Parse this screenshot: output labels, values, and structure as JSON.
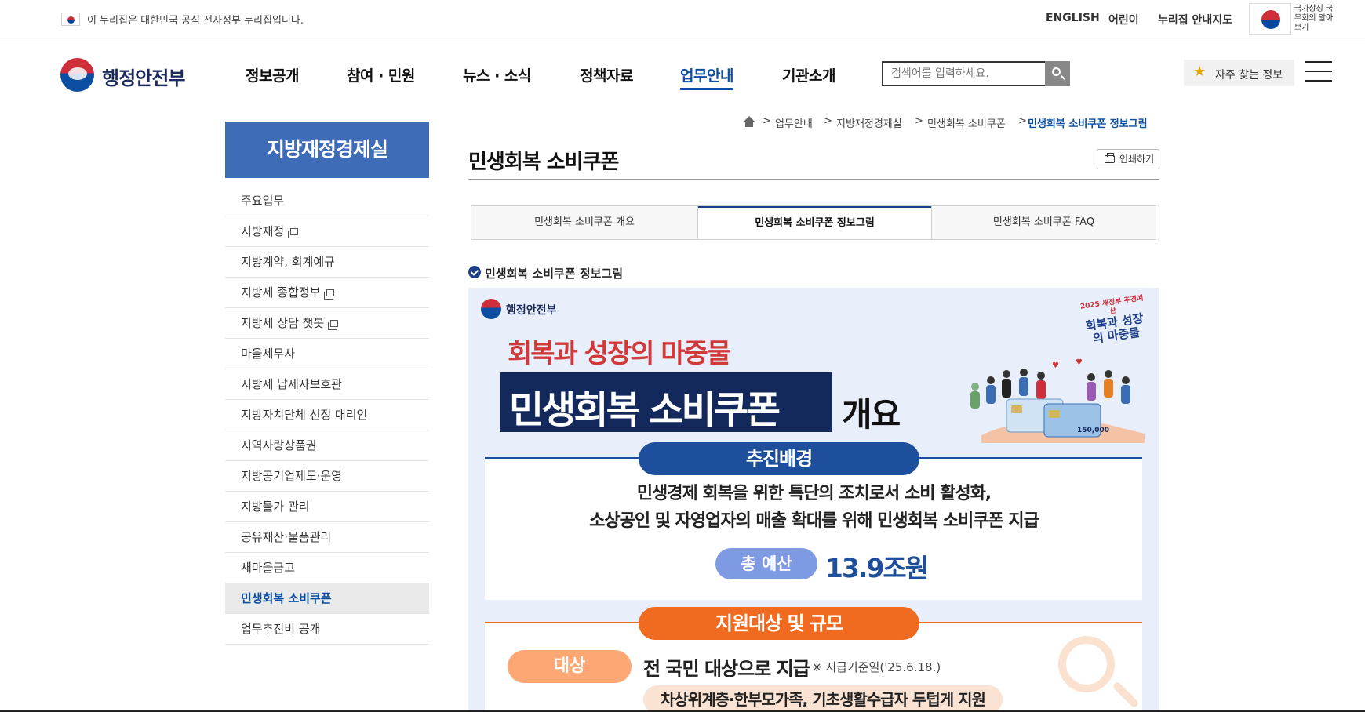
{
  "govbar": {
    "notice": "이 누리집은 대한민국 공식 전자정부 누리집입니다.",
    "links": [
      "ENGLISH",
      "어린이",
      "누리집 안내지도"
    ],
    "national_symbol_label": "국가상징 국무회의 알아보기"
  },
  "header": {
    "logo_text": "행정안전부",
    "gnb": [
      "정보공개",
      "참여 · 민원",
      "뉴스 · 소식",
      "정책자료",
      "업무안내",
      "기관소개"
    ],
    "active_gnb": "업무안내",
    "search_placeholder": "검색어를 입력하세요.",
    "favorite_label": "자주 찾는 정보"
  },
  "lnb": {
    "title": "지방재정경제실",
    "items": [
      {
        "label": "주요업무",
        "external": false
      },
      {
        "label": "지방재정",
        "external": true
      },
      {
        "label": "지방계약, 회계예규",
        "external": false
      },
      {
        "label": "지방세 종합정보",
        "external": true
      },
      {
        "label": "지방세 상담 챗봇",
        "external": true
      },
      {
        "label": "마을세무사",
        "external": false
      },
      {
        "label": "지방세 납세자보호관",
        "external": false
      },
      {
        "label": "지방자치단체 선정 대리인",
        "external": false
      },
      {
        "label": "지역사랑상품권",
        "external": false
      },
      {
        "label": "지방공기업제도·운영",
        "external": false
      },
      {
        "label": "지방물가 관리",
        "external": false
      },
      {
        "label": "공유재산·물품관리",
        "external": false
      },
      {
        "label": "새마을금고",
        "external": false
      },
      {
        "label": "민생회복 소비쿠폰",
        "external": false,
        "active": true
      },
      {
        "label": "업무추진비 공개",
        "external": false
      }
    ]
  },
  "breadcrumb": {
    "items": [
      "업무안내",
      "지방재정경제실",
      "민생회복 소비쿠폰",
      "민생회복 소비쿠폰 정보그림"
    ],
    "separator": ">"
  },
  "page": {
    "title": "민생회복 소비쿠폰",
    "print_label": "인쇄하기"
  },
  "tabs": [
    {
      "label": "민생회복 소비쿠폰 개요",
      "active": false
    },
    {
      "label": "민생회복 소비쿠폰 정보그림",
      "active": true
    },
    {
      "label": "민생회복 소비쿠폰 FAQ",
      "active": false
    }
  ],
  "section": {
    "heading": "민생회복 소비쿠폰 정보그림"
  },
  "infographic": {
    "logo_text": "행정안전부",
    "badge_small": "2025 새정부 추경예산",
    "badge_main": "회복과 성장의 마중물",
    "slogan": "회복과 성장의 마중물",
    "title": "민생회복 소비쿠폰",
    "title_suffix": "개요",
    "card_amount": "150,000",
    "background_heading": "추진배경",
    "background_line1": "민생경제 회복을 위한 특단의 조치로서 소비 활성화,",
    "background_line2": "소상공인 및 자영업자의 매출 확대를 위해 민생회복 소비쿠폰 지급",
    "budget_label": "총 예산",
    "budget_value": "13.9조원",
    "target_heading": "지원대상 및 규모",
    "target_label": "대상",
    "target_text": "전 국민 대상으로 지급",
    "target_note": "※ 지급기준일('25.6.18.)",
    "support_text": "차상위계층·한부모가족, 기초생활수급자 두텁게 지원"
  },
  "colors": {
    "lnb_title_bg": "#3e6cb7",
    "gov_blue": "#0b4ea2",
    "navy": "#13295b",
    "accent_red": "#d23a3a",
    "accent_orange": "#f06b20"
  }
}
